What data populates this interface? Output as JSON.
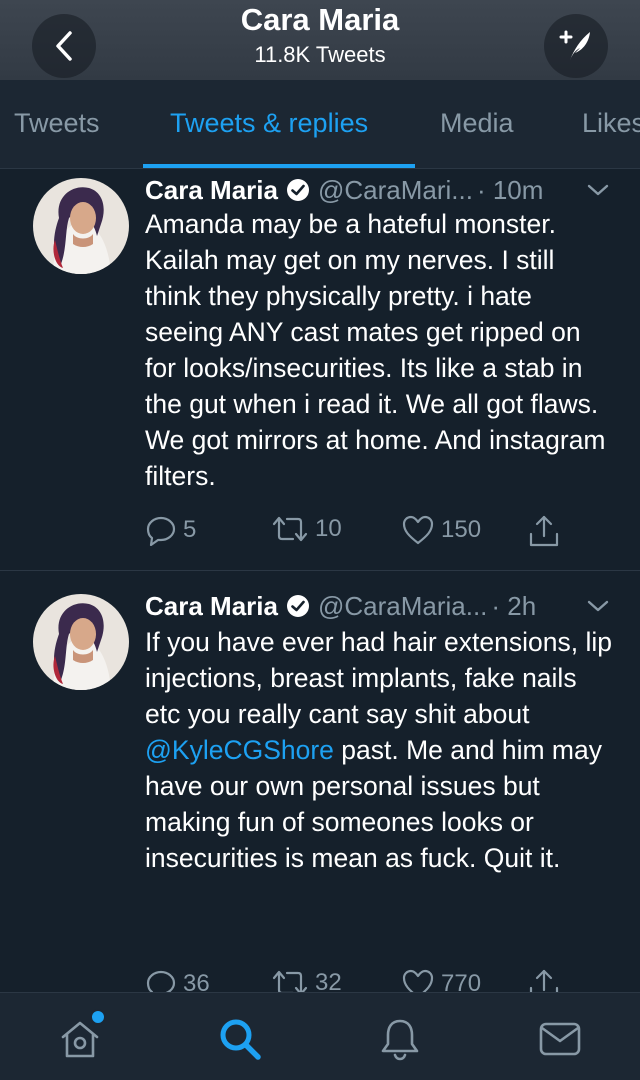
{
  "header": {
    "title": "Cara Maria",
    "subtitle": "11.8K Tweets"
  },
  "tabs": [
    {
      "label": "Tweets",
      "active": false
    },
    {
      "label": "Tweets & replies",
      "active": true
    },
    {
      "label": "Media",
      "active": false
    },
    {
      "label": "Likes",
      "active": false
    }
  ],
  "tweets": [
    {
      "name": "Cara Maria",
      "handle": "@CaraMari...",
      "time": "· 10m",
      "text": "Amanda may be a hateful monster. Kailah may get on my nerves. I still think they physically pretty. i hate seeing ANY cast mates get ripped on for looks/insecurities. Its like a stab in the gut when i read it. We all got flaws. We got mirrors at home. And instagram filters.",
      "replies": "5",
      "retweets": "10",
      "likes": "150"
    },
    {
      "name": "Cara Maria",
      "handle": "@CaraMaria...",
      "time": "· 2h",
      "text_before": "If you have ever had hair extensions, lip injections, breast implants, fake nails etc you really cant say shit about ",
      "mention": "@KyleCGShore",
      "text_after": " past. Me and him may have our own personal issues but making fun of someones looks or insecurities is mean as fuck. Quit it.",
      "replies": "36",
      "retweets": "32",
      "likes": "770"
    }
  ],
  "colors": {
    "background": "#15202b",
    "accent": "#1da1f2",
    "muted": "#8899a6"
  },
  "icons": [
    "back-arrow-icon",
    "compose-tweet-icon",
    "verified-icon",
    "chevron-down-icon",
    "reply-icon",
    "retweet-icon",
    "like-icon",
    "share-icon",
    "home-icon",
    "search-icon",
    "notifications-icon",
    "messages-icon"
  ]
}
